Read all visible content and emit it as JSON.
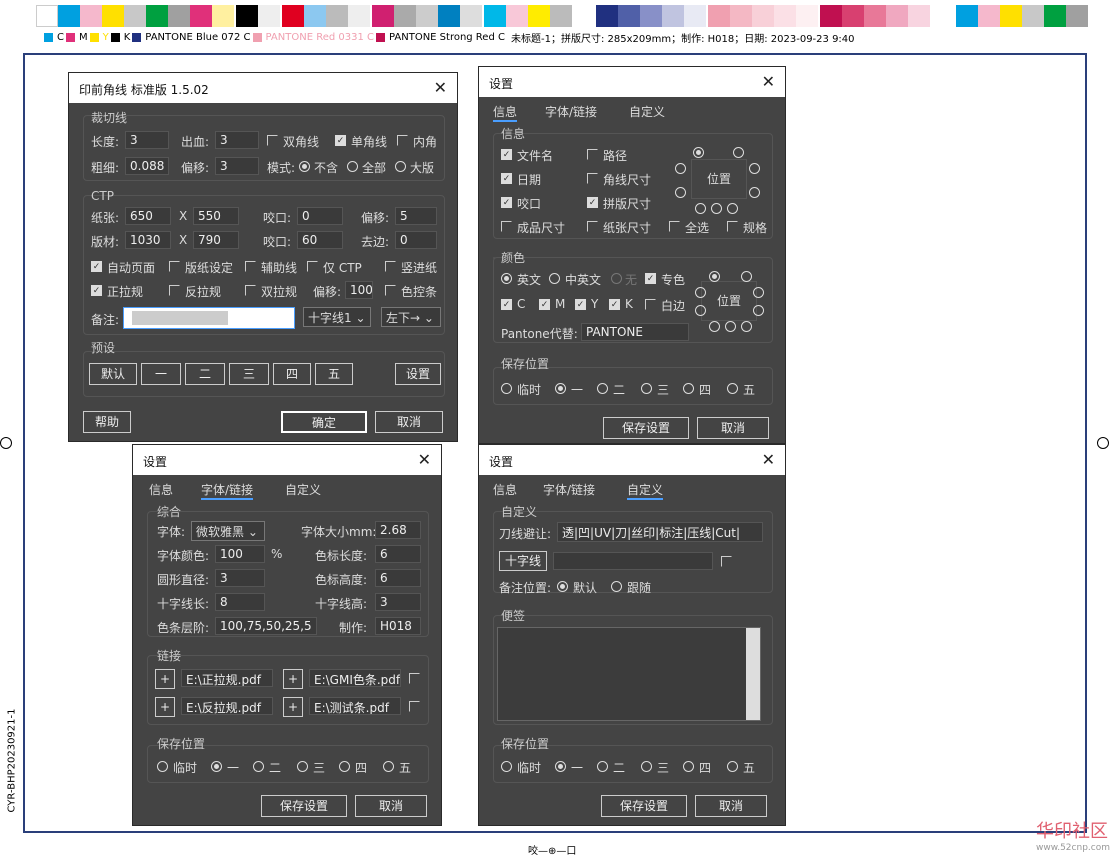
{
  "legend": {
    "c": "C",
    "m": "M",
    "y": "Y",
    "k": "K",
    "p1": "PANTONE Blue 072 C",
    "p2": "PANTONE Red 0331 C",
    "p3": "PANTONE Strong Red C",
    "info": "未标题-1；拼版尺寸: 285x209mm；制作: H018；日期: 2023-09-23 9:40"
  },
  "side_text": "CYR-BHP20230921-1",
  "bottom_text": "咬—⊕—口",
  "watermark": {
    "main": "华印社区",
    "sub": "www.52cnp.com"
  },
  "colors": {
    "accent": "#4a9eff",
    "dialog_bg": "#444444",
    "frame": "#2a3f7a"
  },
  "d1": {
    "title": "印前角线 标准版 1.5.02",
    "cut": {
      "label": "裁切线",
      "len_l": "长度:",
      "len_v": "3",
      "bleed_l": "出血:",
      "bleed_v": "3",
      "dbl": "双角线",
      "single": "单角线",
      "inner": "内角",
      "thick_l": "粗细:",
      "thick_v": "0.088",
      "off_l": "偏移:",
      "off_v": "3",
      "mode_l": "模式:",
      "m1": "不含",
      "m2": "全部",
      "m3": "大版"
    },
    "ctp": {
      "label": "CTP",
      "paper_l": "纸张:",
      "paper_w": "650",
      "paper_h": "550",
      "x": "X",
      "bite_l": "咬口:",
      "bite_v": "0",
      "off_l": "偏移:",
      "off_v": "5",
      "plate_l": "版材:",
      "plate_w": "1030",
      "plate_h": "790",
      "bite2_v": "60",
      "edge_l": "去边:",
      "edge_v": "0",
      "auto": "自动页面",
      "paperset": "版纸设定",
      "aux": "辅助线",
      "onlyctp": "仅 CTP",
      "vert": "竖进纸",
      "pull": "正拉规",
      "rpull": "反拉规",
      "dpull": "双拉规",
      "off2_l": "偏移:",
      "off2_v": "100",
      "colorbar": "色控条",
      "note_l": "备注:",
      "sel1": "十字线1 ⌄",
      "sel2": "左下→ ⌄"
    },
    "preset": {
      "label": "预设",
      "b0": "默认",
      "b1": "一",
      "b2": "二",
      "b3": "三",
      "b4": "四",
      "b5": "五",
      "set": "设置"
    },
    "help": "帮助",
    "ok": "确定",
    "cancel": "取消"
  },
  "d2": {
    "title": "设置",
    "tabs": [
      "信息",
      "字体/链接",
      "自定义"
    ],
    "info": {
      "label": "信息",
      "file": "文件名",
      "path": "路径",
      "date": "日期",
      "csize": "角线尺寸",
      "bite": "咬口",
      "psize": "拼版尺寸",
      "fsize": "成品尺寸",
      "paper": "纸张尺寸",
      "all": "全选",
      "spec": "规格",
      "pos": "位置"
    },
    "color": {
      "label": "颜色",
      "en": "英文",
      "cnen": "中英文",
      "none": "无",
      "spot": "专色",
      "c": "C",
      "m": "M",
      "y": "Y",
      "k": "K",
      "white": "白边",
      "pan_l": "Pantone代替:",
      "pan_v": "PANTONE",
      "pos": "位置"
    },
    "save": {
      "label": "保存位置",
      "t": "临时",
      "s1": "一",
      "s2": "二",
      "s3": "三",
      "s4": "四",
      "s5": "五"
    },
    "savebtn": "保存设置",
    "cancel": "取消"
  },
  "d3": {
    "title": "设置",
    "tabs": [
      "信息",
      "字体/链接",
      "自定义"
    ],
    "gen": {
      "label": "综合",
      "font_l": "字体:",
      "font_v": "微软雅黑 ⌄",
      "fsize_l": "字体大小mm:",
      "fsize_v": "2.68",
      "fcolor_l": "字体颜色:",
      "fcolor_v": "100",
      "pct": "%",
      "mlen_l": "色标长度:",
      "mlen_v": "6",
      "circ_l": "圆形直径:",
      "circ_v": "3",
      "mh_l": "色标高度:",
      "mh_v": "6",
      "cl_l": "十字线长:",
      "cl_v": "8",
      "ch_l": "十字线高:",
      "ch_v": "3",
      "grad_l": "色条层阶:",
      "grad_v": "100,75,50,25,5",
      "maker_l": "制作:",
      "maker_v": "H018"
    },
    "link": {
      "label": "链接",
      "a": "E:\\正拉规.pdf",
      "b": "E:\\GMI色条.pdf",
      "c": "E:\\反拉规.pdf",
      "d": "E:\\测试条.pdf",
      "plus": "+"
    },
    "save": {
      "label": "保存位置",
      "t": "临时",
      "s1": "一",
      "s2": "二",
      "s3": "三",
      "s4": "四",
      "s5": "五"
    },
    "savebtn": "保存设置",
    "cancel": "取消"
  },
  "d4": {
    "title": "设置",
    "tabs": [
      "信息",
      "字体/链接",
      "自定义"
    ],
    "custom": {
      "label": "自定义",
      "knife_l": "刀线避让:",
      "knife_v": "透|凹|UV|刀|丝印|标注|压线|Cut|",
      "cross": "十字线",
      "notepos_l": "备注位置:",
      "def": "默认",
      "follow": "跟随"
    },
    "memo": {
      "label": "便签"
    },
    "save": {
      "label": "保存位置",
      "t": "临时",
      "s1": "一",
      "s2": "二",
      "s3": "三",
      "s4": "四",
      "s5": "五"
    },
    "savebtn": "保存设置",
    "cancel": "取消"
  }
}
